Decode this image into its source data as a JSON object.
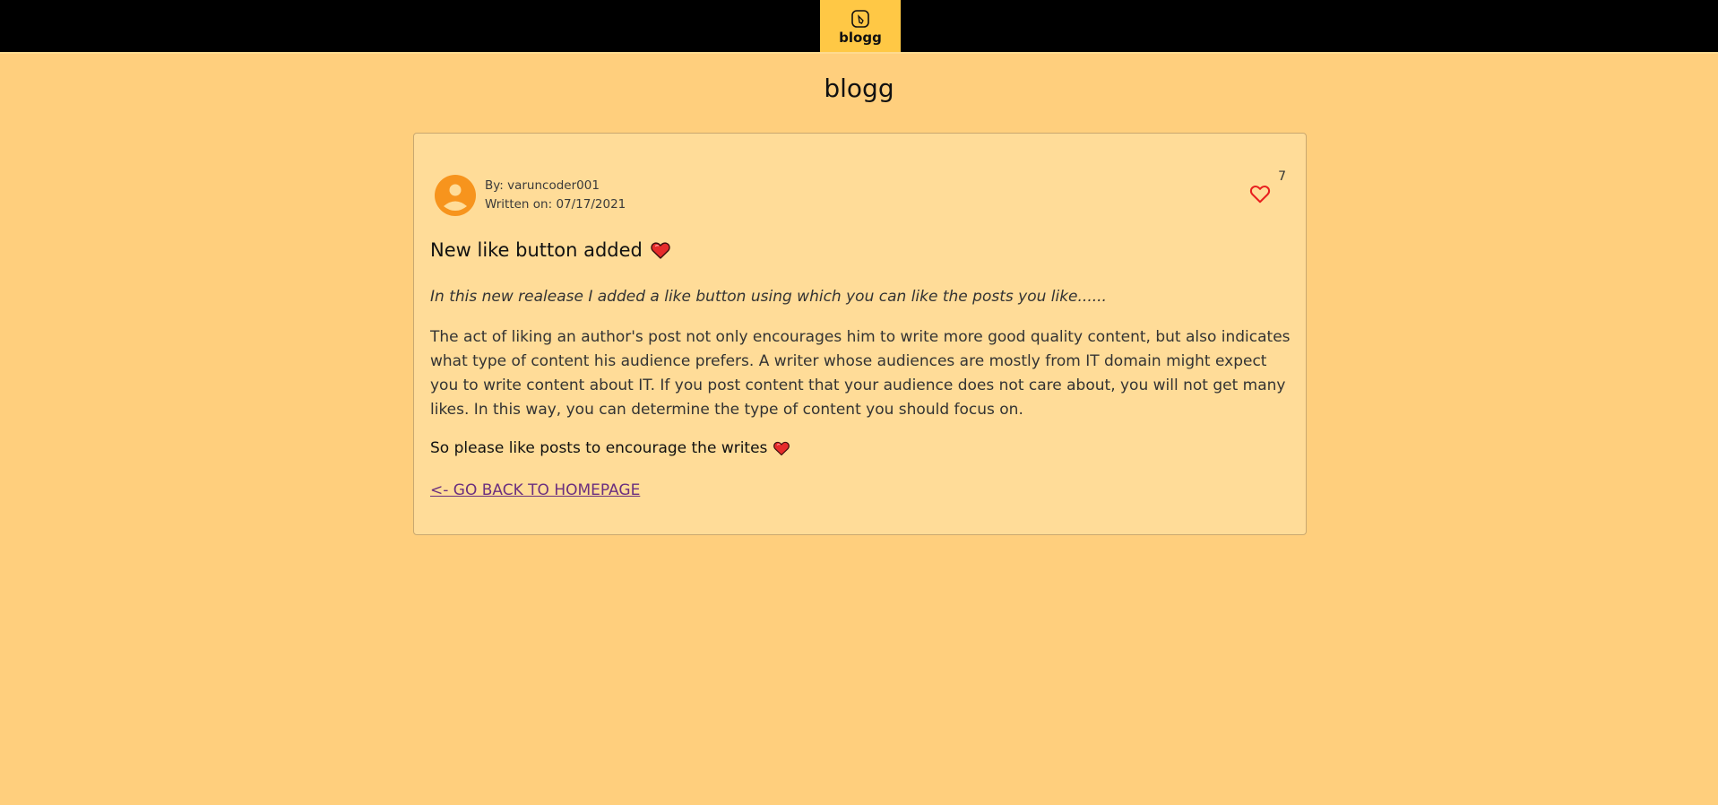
{
  "header": {
    "logo_text": "blogg",
    "logo_bg": "#ffc845"
  },
  "site": {
    "title": "blogg"
  },
  "post": {
    "author_line": "By: varuncoder001",
    "date_line": "Written on: 07/17/2021",
    "like_count": "7",
    "title": "New like button added",
    "lead": "In this new realease I added a like button using which you can like the posts you like......",
    "body": "The act of liking an author's post not only encourages him to write more good quality content, but also indicates what type of content his audience prefers. A writer whose audiences are mostly from IT domain might expect you to write content about IT. If you post content that your audience does not care about, you will not get many likes. In this way, you can determine the type of content you should focus on.",
    "closing": "So please like posts to encourage the writes",
    "back_link": "<- GO BACK TO HOMEPAGE"
  },
  "colors": {
    "page_bg": "#ffcf7d",
    "card_bg": "#ffdc98",
    "avatar": "#f7941d",
    "like_heart": "#e8201f",
    "link": "#6b2f7f"
  },
  "icons": [
    "logo-icon",
    "avatar-icon",
    "heart-outline-icon",
    "heart-emoji-icon"
  ]
}
